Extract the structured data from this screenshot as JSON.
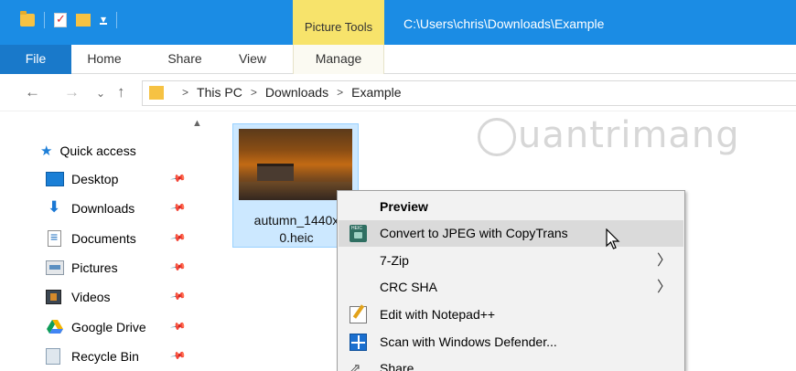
{
  "window": {
    "title_path": "C:\\Users\\chris\\Downloads\\Example",
    "contextual_tab_group": "Picture Tools"
  },
  "ribbon": {
    "tabs": [
      {
        "label": "File"
      },
      {
        "label": "Home"
      },
      {
        "label": "Share"
      },
      {
        "label": "View"
      },
      {
        "label": "Manage"
      }
    ]
  },
  "address": {
    "breadcrumbs": [
      "This PC",
      "Downloads",
      "Example"
    ]
  },
  "sidebar": {
    "items": [
      {
        "label": "Quick access",
        "icon": "star-icon"
      },
      {
        "label": "Desktop",
        "icon": "desktop-icon"
      },
      {
        "label": "Downloads",
        "icon": "downloads-icon"
      },
      {
        "label": "Documents",
        "icon": "documents-icon"
      },
      {
        "label": "Pictures",
        "icon": "pictures-icon"
      },
      {
        "label": "Videos",
        "icon": "videos-icon"
      },
      {
        "label": "Google Drive",
        "icon": "google-drive-icon"
      },
      {
        "label": "Recycle Bin",
        "icon": "recycle-bin-icon"
      }
    ]
  },
  "files": [
    {
      "name_line1": "autumn_1440x",
      "name_line2": "0.heic"
    }
  ],
  "watermark": {
    "text": "uantrimang"
  },
  "context_menu": {
    "items": [
      {
        "label": "Preview",
        "bold": true
      },
      {
        "label": "Convert to JPEG with CopyTrans",
        "icon": "heic-icon",
        "hover": true
      },
      {
        "label": "7-Zip",
        "submenu": true
      },
      {
        "label": "CRC SHA",
        "submenu": true
      },
      {
        "label": "Edit with Notepad++",
        "icon": "notepad-plus-plus-icon"
      },
      {
        "label": "Scan with Windows Defender...",
        "icon": "windows-defender-icon"
      },
      {
        "label": "Share",
        "icon": "share-icon"
      }
    ]
  },
  "colors": {
    "titlebar": "#1b8ce4",
    "file_tab": "#1979ca",
    "picture_tools": "#f7e36b",
    "selection": "#cce8ff"
  }
}
